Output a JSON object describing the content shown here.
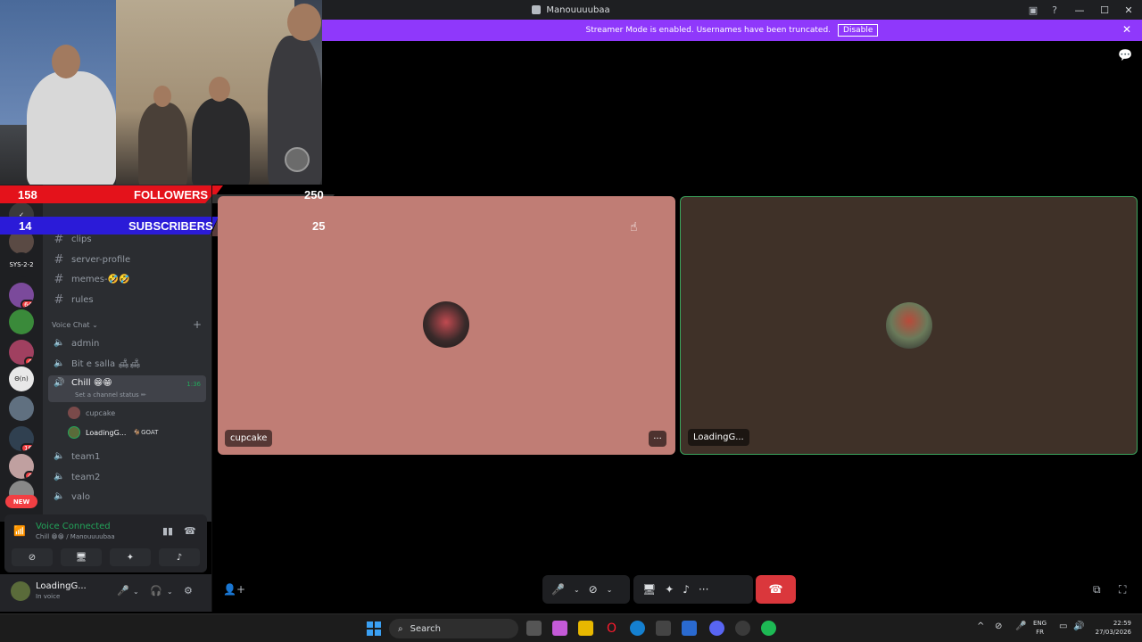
{
  "window": {
    "title": "Manouuuubaa"
  },
  "banner": {
    "text": "Streamer Mode is enabled. Usernames have been truncated.",
    "disable_label": "Disable"
  },
  "overlay": {
    "followers": {
      "current": "158",
      "label": "FOLLOWERS",
      "goal": "250"
    },
    "subscribers": {
      "current": "14",
      "label": "SUBSCRIBERS",
      "goal": "25"
    }
  },
  "servers": [
    {
      "name": "SYS-2-2",
      "badge": ""
    },
    {
      "name": "",
      "badge": "64"
    },
    {
      "name": "",
      "badge": ""
    },
    {
      "name": "",
      "badge": "4"
    },
    {
      "name": "Θ(n)",
      "badge": ""
    },
    {
      "name": "",
      "badge": ""
    },
    {
      "name": "",
      "badge": "16"
    },
    {
      "name": "",
      "badge": "4"
    },
    {
      "name": "",
      "badge": ""
    }
  ],
  "new_badge": "NEW",
  "channels": {
    "text": [
      "clips",
      "server-profile",
      "memes-🤣🤣",
      "rules"
    ],
    "voice_category": "Voice Chat",
    "voice": [
      "admin",
      "Bit e salla 🛋🛋"
    ],
    "active": {
      "name": "Chill 😁😁",
      "status": "Set a channel status ✏",
      "time": "1:36"
    },
    "members": [
      {
        "name": "cupcake",
        "tag": ""
      },
      {
        "name": "LoadingG...",
        "tag": "🐐GOAT"
      }
    ],
    "more_voice": [
      "team1",
      "team2",
      "valo"
    ]
  },
  "voice_panel": {
    "status": "Voice Connected",
    "channel": "Chill 😁😁 / Manouuuubaa"
  },
  "user": {
    "name": "LoadingG...",
    "status": "In voice"
  },
  "tiles": [
    {
      "name": "cupcake",
      "more": "···"
    },
    {
      "name": "LoadingG..."
    }
  ],
  "controls": {
    "more": "···"
  },
  "taskbar": {
    "search": "Search",
    "lang_top": "ENG",
    "lang_bottom": "FR",
    "time": "22:59",
    "date": "27/03/2026"
  },
  "colors": {
    "banner": "#8f38fb",
    "leave": "#da373c",
    "speaking": "#3ba55d",
    "followers_bar": "#e4121b",
    "subs_bar": "#2b1bd8"
  }
}
